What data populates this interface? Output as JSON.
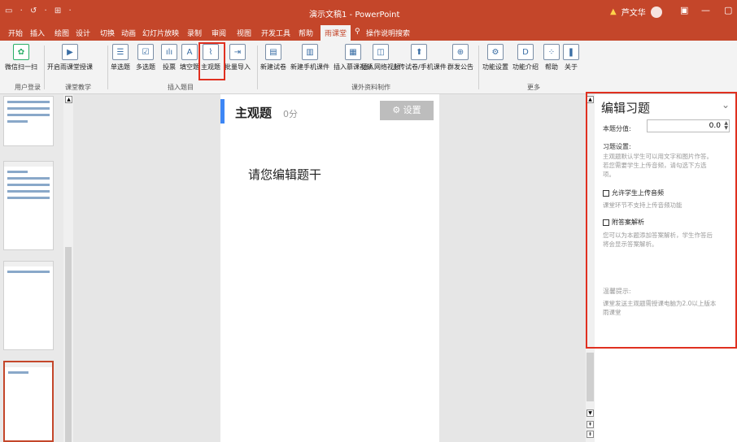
{
  "titlebar": {
    "quick_access": "▭ · ↺ · ⊞ ·",
    "title": "演示文稿1 - PowerPoint",
    "warning": "▲",
    "user": "芦文华",
    "ribbon_options": "▣",
    "minimize": "—",
    "close": "▢"
  },
  "tabs": [
    {
      "label": "开始"
    },
    {
      "label": "插入"
    },
    {
      "label": "绘图"
    },
    {
      "label": "设计"
    },
    {
      "label": "切换"
    },
    {
      "label": "动画"
    },
    {
      "label": "幻灯片放映"
    },
    {
      "label": "录制"
    },
    {
      "label": "审阅"
    },
    {
      "label": "视图"
    },
    {
      "label": "开发工具"
    },
    {
      "label": "帮助"
    },
    {
      "label": "雨课堂"
    },
    {
      "label": "操作说明搜索"
    }
  ],
  "ribbon": {
    "buttons": [
      {
        "label": "微信扫一扫",
        "icon": "wechat-icon"
      },
      {
        "label": "开启雨课堂授课",
        "icon": "play-icon"
      },
      {
        "label": "单选题",
        "icon": "single-choice-icon"
      },
      {
        "label": "多选题",
        "icon": "multi-choice-icon"
      },
      {
        "label": "投票",
        "icon": "vote-icon"
      },
      {
        "label": "填空题",
        "icon": "fill-blank-icon"
      },
      {
        "label": "主观题",
        "icon": "subjective-icon"
      },
      {
        "label": "批量导入",
        "icon": "batch-import-icon"
      },
      {
        "label": "新建试卷",
        "icon": "new-exam-icon"
      },
      {
        "label": "新建手机课件",
        "icon": "new-mobile-courseware-icon"
      },
      {
        "label": "插入慕课视频",
        "icon": "mooc-video-icon"
      },
      {
        "label": "插入网络视频",
        "icon": "web-video-icon"
      },
      {
        "label": "上传试卷/手机课件",
        "icon": "upload-icon"
      },
      {
        "label": "群发公告",
        "icon": "broadcast-icon"
      },
      {
        "label": "功能设置",
        "icon": "settings-icon"
      },
      {
        "label": "功能介绍",
        "icon": "intro-icon"
      },
      {
        "label": "帮助",
        "icon": "help-icon"
      },
      {
        "label": "关于",
        "icon": "about-icon"
      }
    ],
    "icon_glyphs": [
      "✿",
      "▶",
      "☰",
      "☑",
      "ılı",
      "A",
      "⌇",
      "⇥",
      "▤",
      "▥",
      "▦",
      "◫",
      "⬆",
      "⊕",
      "⚙",
      "D",
      "⁘",
      "❚"
    ],
    "groups": [
      {
        "label": "用户登录"
      },
      {
        "label": "课堂教学"
      },
      {
        "label": "插入题目"
      },
      {
        "label": "课外资料制作"
      },
      {
        "label": "更多"
      }
    ]
  },
  "slide": {
    "title": "主观题",
    "score": "0分",
    "settings_button": "⚙ 设置",
    "stem": "请您编辑题干"
  },
  "panel": {
    "title": "编辑习题",
    "collapse": "⌄",
    "score_label": "本题分值:",
    "score_value": "0.0",
    "settings_title": "习题设置:",
    "settings_text": "主观题默认学生可以用文字和图片作答。若您需要学生上传音频，请勾选下方选项。",
    "audio_option": "允许学生上传音频",
    "audio_note": "课堂环节不支持上传音频功能",
    "answer_option": "附答案解析",
    "answer_note": "您可以为本题添加答案解析，学生作答后将会显示答案解析。",
    "tip_title": "温馨提示:",
    "tip_text": "课堂发送主观题需授课电脑为2.0以上版本雨课堂"
  }
}
